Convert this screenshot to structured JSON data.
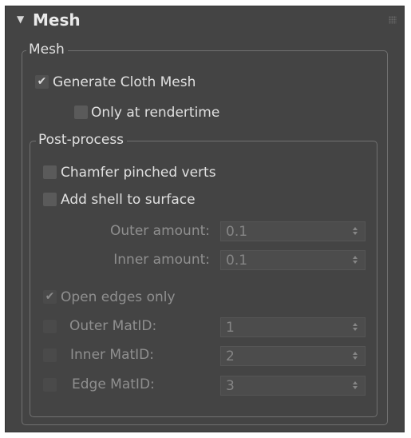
{
  "rollout": {
    "arrow": "▼",
    "title": "Mesh",
    "drag_handle_icon": "grip-dots-icon"
  },
  "mesh_group": {
    "title": "Mesh",
    "generate_cloth_mesh": {
      "label": "Generate Cloth Mesh",
      "checked": true,
      "enabled": true
    },
    "only_at_rendertime": {
      "label": "Only at rendertime",
      "checked": false,
      "enabled": true
    }
  },
  "post_process": {
    "title": "Post-process",
    "chamfer_pinched_verts": {
      "label": "Chamfer pinched verts",
      "checked": false,
      "enabled": true
    },
    "add_shell_to_surface": {
      "label": "Add shell to surface",
      "checked": false,
      "enabled": true
    },
    "outer_amount": {
      "label": "Outer amount:",
      "value": "0.1",
      "enabled": false
    },
    "inner_amount": {
      "label": "Inner amount:",
      "value": "0.1",
      "enabled": false
    },
    "open_edges_only": {
      "label": "Open edges only",
      "checked": true,
      "enabled": false
    },
    "outer_matid": {
      "label": "Outer MatID:",
      "value": "1",
      "checked": false,
      "enabled": false
    },
    "inner_matid": {
      "label": "Inner MatID:",
      "value": "2",
      "checked": false,
      "enabled": false
    },
    "edge_matid": {
      "label": "Edge MatID:",
      "value": "3",
      "checked": false,
      "enabled": false
    }
  },
  "glyphs": {
    "check": "✔"
  },
  "colors": {
    "panel_background": "#444444",
    "group_border": "#717171",
    "enabled_text": "#e0e0e0",
    "disabled_text": "#8f8f8f"
  }
}
